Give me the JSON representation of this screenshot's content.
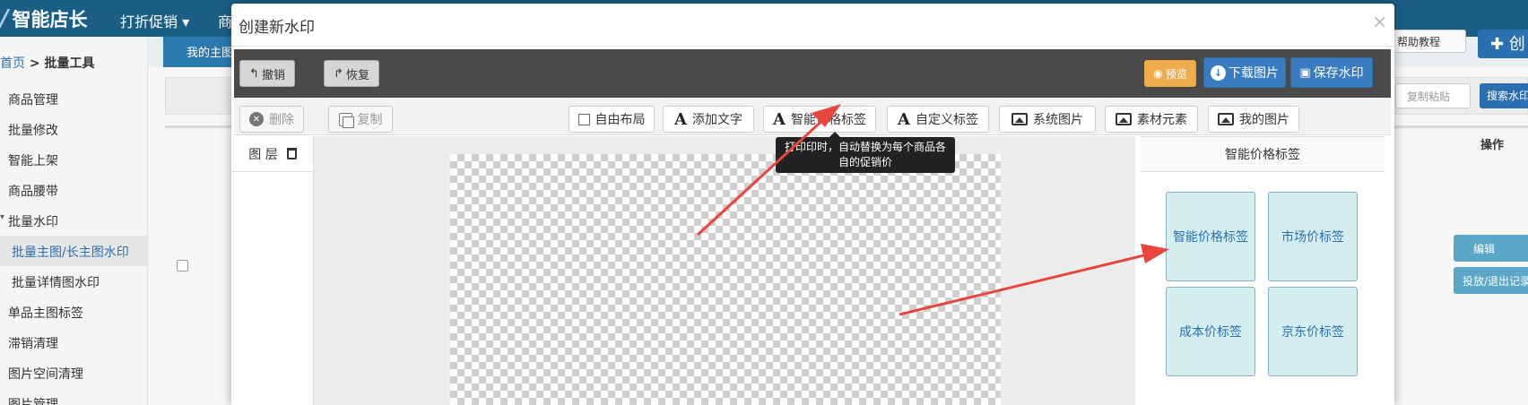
{
  "app": {
    "logo": "智能店长",
    "nav": [
      "打折促销 ▾",
      "商"
    ],
    "tab": "我的主图",
    "breadcrumb": {
      "home": "首页",
      "sep": " > ",
      "current": "批量工具"
    },
    "help_button": "帮助教程",
    "plus_button": "✚ 创",
    "paste_button": "复制粘贴",
    "search_button": "搜索水印",
    "ops_header": "操作",
    "edit_button": "编辑",
    "putout_button": "投放/退出记录"
  },
  "sidebar": {
    "items": [
      {
        "label": "商品管理"
      },
      {
        "label": "批量修改"
      },
      {
        "label": "智能上架"
      },
      {
        "label": "商品腰带"
      },
      {
        "label": "批量水印"
      },
      {
        "label": "批量主图/长主图水印"
      },
      {
        "label": "批量详情图水印"
      },
      {
        "label": "单品主图标签"
      },
      {
        "label": "滞销清理"
      },
      {
        "label": "图片空间清理"
      },
      {
        "label": "图片管理"
      }
    ]
  },
  "modal": {
    "title": "创建新水印",
    "close": "×",
    "toolbar": {
      "undo": "撤销",
      "redo": "恢复",
      "preview": "预览",
      "download": "下载图片",
      "save": "保存水印"
    },
    "tools": {
      "delete": "删除",
      "copy": "复制",
      "free_layout": "自由布局",
      "add_text": "添加文字",
      "smart_price_tag": "智能价格标签",
      "custom_tag": "自定义标签",
      "system_image": "系统图片",
      "material": "素材元素",
      "my_image": "我的图片"
    },
    "layers_label": "图 层",
    "tooltip": "打印印时，自动替换为每个商品各自的促销价",
    "panel": {
      "title": "智能价格标签",
      "tags": [
        "智能价格标签",
        "市场价标签",
        "成本价标签",
        "京东价标签"
      ]
    }
  },
  "colors": {
    "nav_bg": "#1b5f86",
    "toolbar_bg": "#4a4a4a",
    "primary": "#3a7cc2",
    "warning": "#f0ad4e",
    "tag_bg": "#d4eef0",
    "arrow": "#e8453c"
  }
}
